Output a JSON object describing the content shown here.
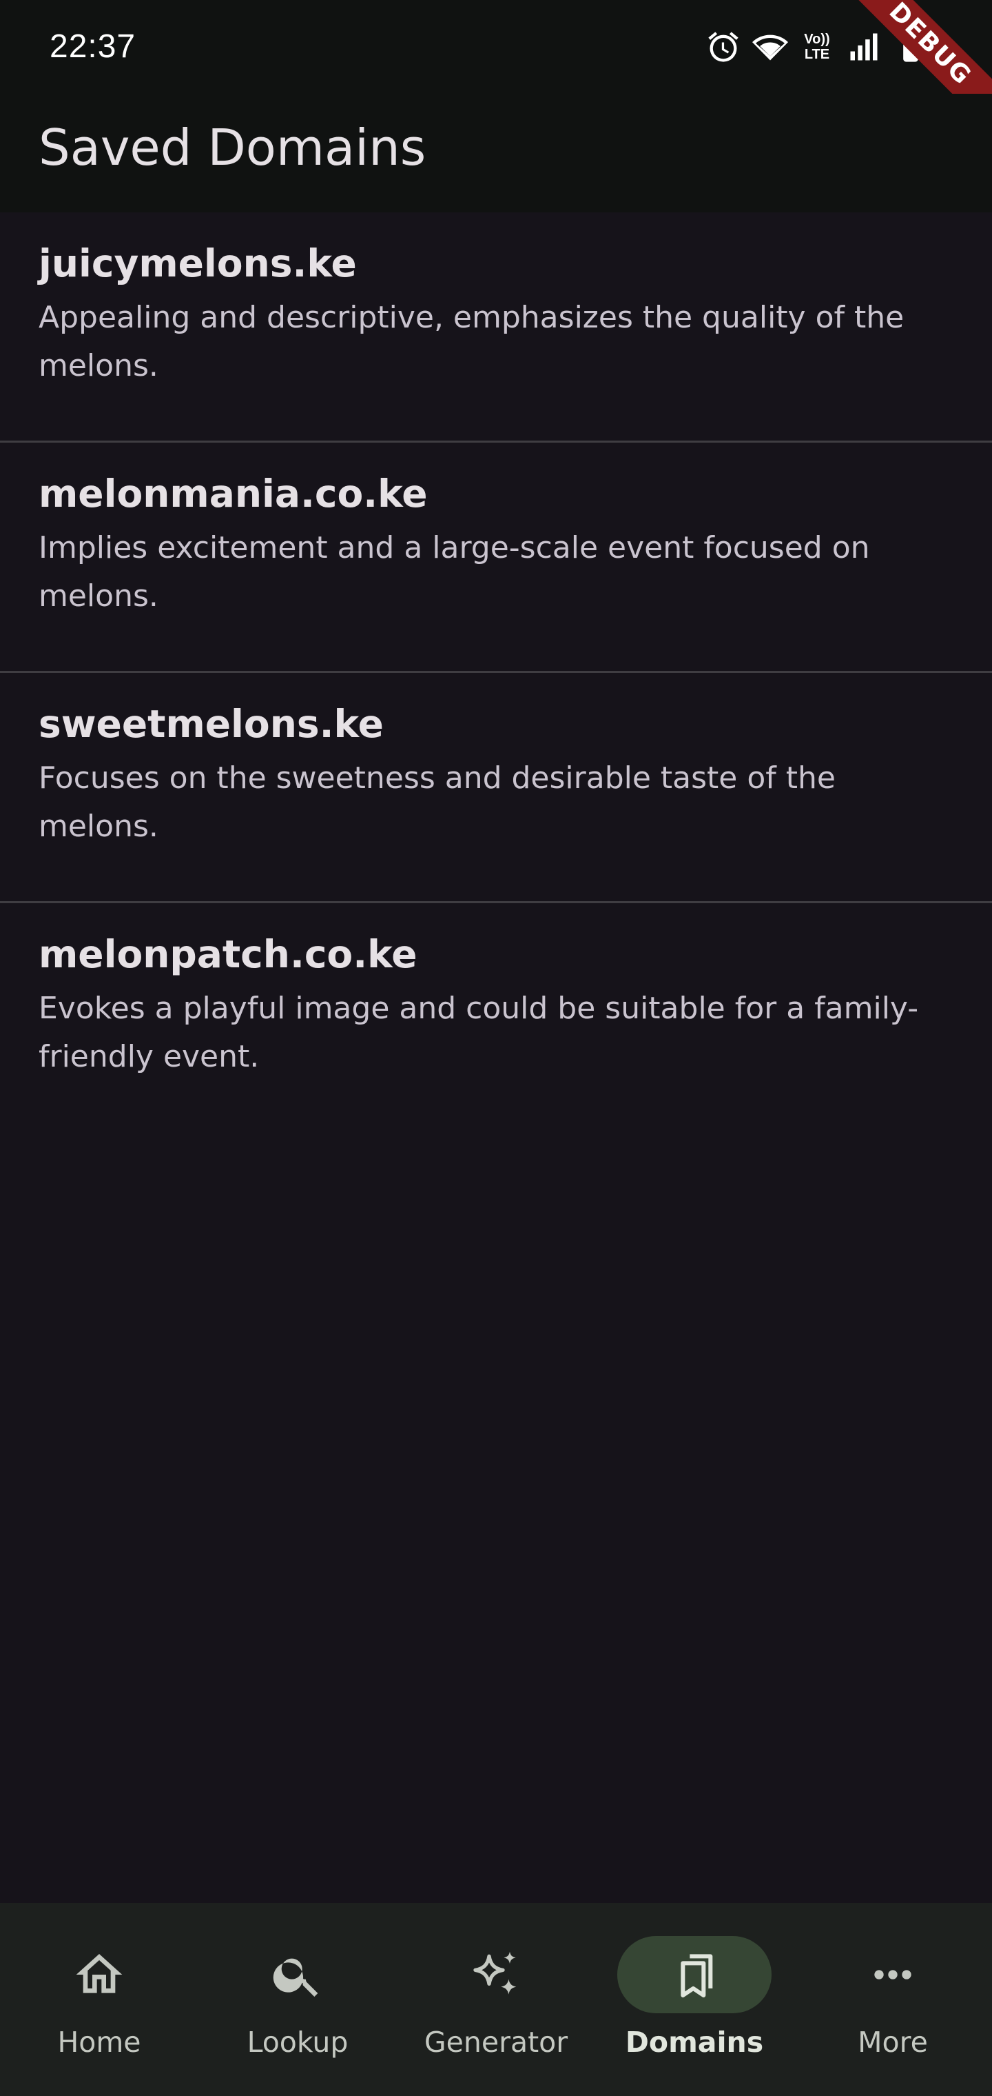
{
  "status_bar": {
    "time": "22:37",
    "icons": [
      "alarm-icon",
      "wifi-icon",
      "volte-icon",
      "signal-icon",
      "battery-icon"
    ],
    "volte_text": [
      "Vo))",
      "LTE"
    ]
  },
  "debug_banner": "DEBUG",
  "app_bar": {
    "title": "Saved Domains"
  },
  "domains": [
    {
      "name": "juicymelons.ke",
      "description": "Appealing and descriptive, emphasizes the quality of the melons."
    },
    {
      "name": "melonmania.co.ke",
      "description": "Implies excitement and a large-scale event focused on melons."
    },
    {
      "name": "sweetmelons.ke",
      "description": "Focuses on the sweetness and desirable taste of the melons."
    },
    {
      "name": "melonpatch.co.ke",
      "description": "Evokes a playful image and could be suitable for a family-friendly event."
    }
  ],
  "bottom_nav": {
    "items": [
      {
        "label": "Home",
        "icon": "home-icon",
        "active": false
      },
      {
        "label": "Lookup",
        "icon": "search-icon",
        "active": false
      },
      {
        "label": "Generator",
        "icon": "sparkle-icon",
        "active": false
      },
      {
        "label": "Domains",
        "icon": "bookmarks-icon",
        "active": true
      },
      {
        "label": "More",
        "icon": "more-horiz-icon",
        "active": false
      }
    ]
  },
  "colors": {
    "background": "#16131a",
    "app_bar": "#101211",
    "nav_bar": "#1d201e",
    "active_indicator": "#364634",
    "debug_banner": "#8a1b1b"
  }
}
